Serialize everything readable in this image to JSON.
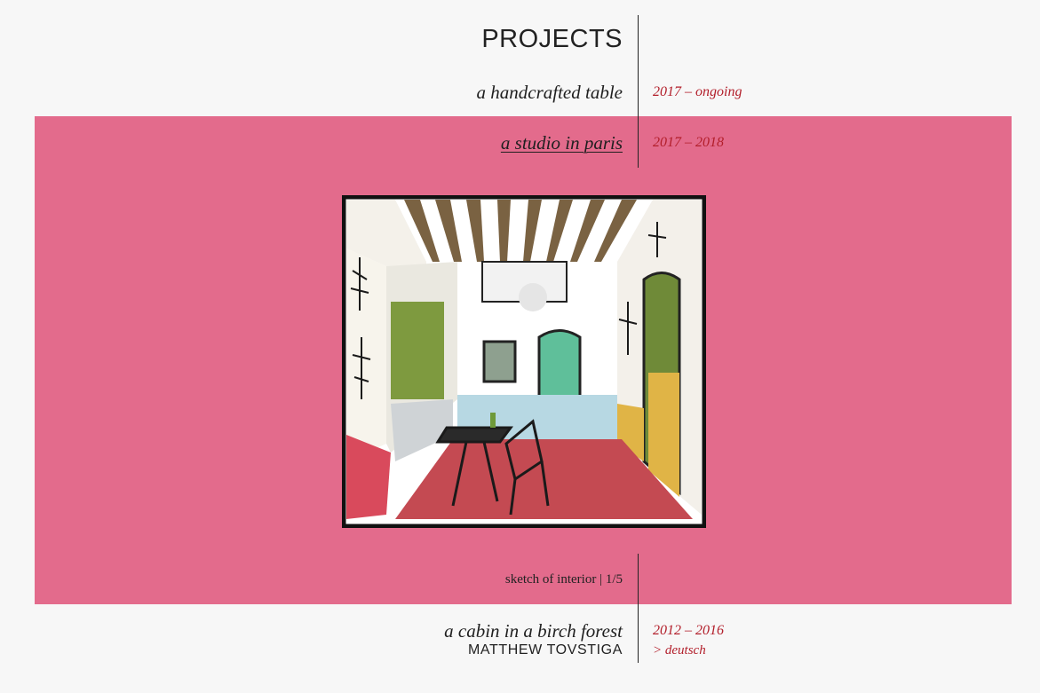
{
  "header": {
    "title": "PROJECTS"
  },
  "projects": [
    {
      "title": "a handcrafted table",
      "date": "2017 – ongoing"
    },
    {
      "title": "a studio in paris",
      "date": "2017 – 2018"
    },
    {
      "title": "a cabin in a birch forest",
      "date": "2012 – 2016"
    }
  ],
  "gallery": {
    "caption": "sketch of interior | 1/5",
    "image_icon": "sketch-illustration"
  },
  "footer": {
    "name": "MATTHEW TOVSTIGA",
    "language_link": "> deutsch"
  },
  "colors": {
    "highlight": "#e36b8c",
    "date_text": "#b21e2a",
    "background": "#f7f7f7"
  }
}
